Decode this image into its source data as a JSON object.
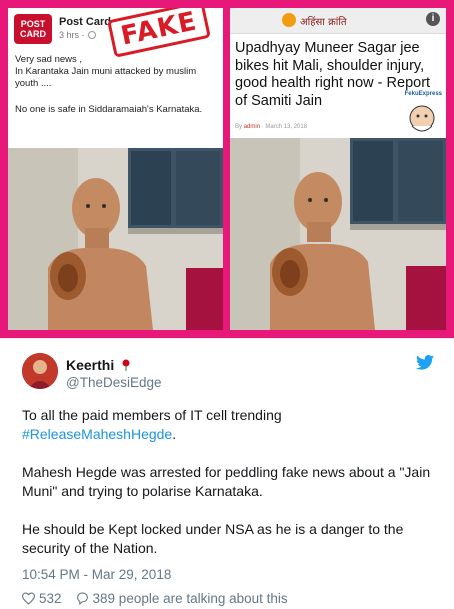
{
  "collage": {
    "left_post": {
      "logo_text": "POST CARD",
      "author": "Post Card",
      "time": "3 hrs ·",
      "lines": [
        "Very sad news ,",
        "In Karantaka Jain muni  attacked by muslim youth ....",
        "No one is safe in Siddaramaiah's Karnataka."
      ],
      "stamp": "FAKE"
    },
    "right_post": {
      "site_title": "अहिंसा क्रांति",
      "headline": "Upadhyay Muneer Sagar jee bikes hit Mali, shoulder injury, good health right now - Report of Samiti Jain",
      "byline_prefix": "By",
      "byline_author": "admin",
      "byline_date": "March 13, 2018",
      "badge_text": "FekuExpress"
    }
  },
  "tweet": {
    "display_name": "Keerthi",
    "handle": "@TheDesiEdge",
    "body": {
      "p1_text": "To all the paid members of IT cell trending",
      "p1_hashtag": "#ReleaseMaheshHegde",
      "p1_suffix": ".",
      "p2": "Mahesh Hegde was arrested for peddling fake news about a \"Jain Muni\" and trying to polarise Karnataka.",
      "p3": "He should be Kept locked under NSA as he is a danger to the security of the Nation."
    },
    "timestamp": "10:54 PM - Mar 29, 2018",
    "likes": "532",
    "talking": "389 people are talking about this"
  },
  "colors": {
    "collage_border": "#e8177a",
    "twitter_blue": "#1b95e0",
    "muted": "#657786"
  },
  "icons": [
    "globe-icon",
    "info-icon",
    "rose-icon",
    "twitter-bird-icon",
    "heart-icon",
    "comment-icon"
  ]
}
